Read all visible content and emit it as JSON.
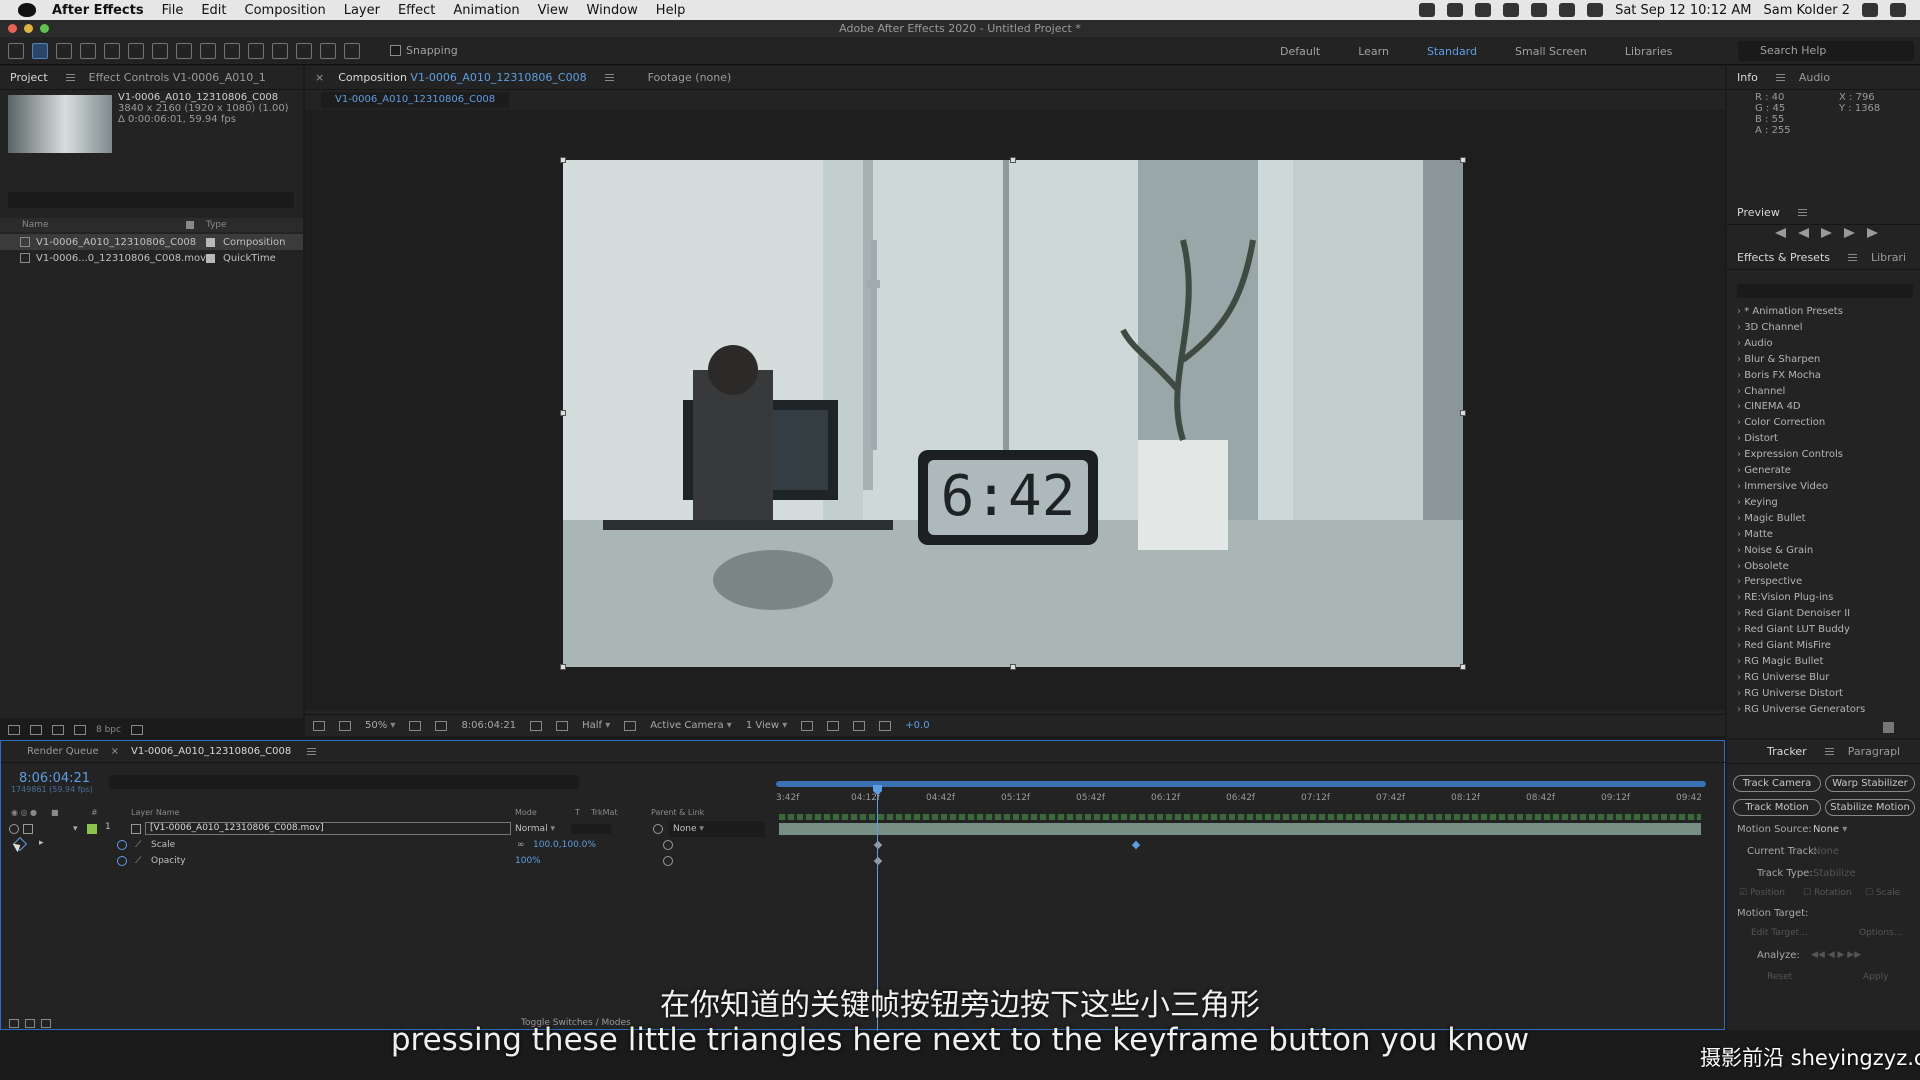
{
  "menubar": {
    "app_name": "After Effects",
    "items": [
      "File",
      "Edit",
      "Composition",
      "Layer",
      "Effect",
      "Animation",
      "View",
      "Window",
      "Help"
    ],
    "clock": "Sat Sep 12  10:12 AM",
    "user": "Sam Kolder 2"
  },
  "window_title": "Adobe After Effects 2020 - Untitled Project *",
  "toolbar": {
    "snapping_label": "Snapping",
    "workspaces": [
      "Default",
      "Learn",
      "Standard",
      "Small Screen",
      "Libraries"
    ],
    "active_workspace": "Standard",
    "search_placeholder": "Search Help"
  },
  "project": {
    "tab_project": "Project",
    "tab_effect_controls": "Effect Controls V1-0006_A010_1",
    "selected_name": "V1-0006_A010_12310806_C008",
    "resolution": "3840 x 2160  (1920 x 1080) (1.00)",
    "duration": "Δ 0:00:06:01, 59.94 fps",
    "col_name": "Name",
    "col_type": "Type",
    "bpc": "8 bpc",
    "items": [
      {
        "name": "V1-0006_A010_12310806_C008",
        "type": "Composition"
      },
      {
        "name": "V1-0006...0_12310806_C008.mov",
        "type": "QuickTime"
      }
    ]
  },
  "composition": {
    "tab_label": "Composition",
    "comp_name": "V1-0006_A010_12310806_C008",
    "footage_tab": "Footage (none)",
    "sub_tab": "V1-0006_A010_12310806_C008",
    "zoom": "50%",
    "timecode": "8:06:04:21",
    "resolution": "Half",
    "camera": "Active Camera",
    "views": "1 View",
    "exposure": "+0.0",
    "clock_display": "6:42"
  },
  "info": {
    "tab_info": "Info",
    "tab_audio": "Audio",
    "r": "R : 40",
    "g": "G : 45",
    "b": "B : 55",
    "a": "A : 255",
    "x": "X : 796",
    "y": "Y : 1368"
  },
  "preview": {
    "tab": "Preview"
  },
  "effects": {
    "tab": "Effects & Presets",
    "tab_libraries": "Librari",
    "items": [
      "* Animation Presets",
      "3D Channel",
      "Audio",
      "Blur & Sharpen",
      "Boris FX Mocha",
      "Channel",
      "CINEMA 4D",
      "Color Correction",
      "Distort",
      "Expression Controls",
      "Generate",
      "Immersive Video",
      "Keying",
      "Magic Bullet",
      "Matte",
      "Noise & Grain",
      "Obsolete",
      "Perspective",
      "RE:Vision Plug-ins",
      "Red Giant Denoiser II",
      "Red Giant LUT Buddy",
      "Red Giant MisFire",
      "RG Magic Bullet",
      "RG Universe Blur",
      "RG Universe Distort",
      "RG Universe Generators"
    ]
  },
  "timeline": {
    "tab_render_queue": "Render Queue",
    "tab_comp": "V1-0006_A010_12310806_C008",
    "current_time": "8:06:04:21",
    "frame_info": "1749861 (59.94 fps)",
    "col_layer_name": "Layer Name",
    "col_mode": "Mode",
    "col_t": "T",
    "col_trkmat": "TrkMat",
    "col_parent": "Parent & Link",
    "col_num": "#",
    "layer_index": "1",
    "layer_name": "[V1-0006_A010_12310806_C008.mov]",
    "layer_mode": "Normal",
    "layer_parent": "None",
    "props": [
      {
        "name": "Scale",
        "value": "100.0,100.0%"
      },
      {
        "name": "Opacity",
        "value": "100%"
      }
    ],
    "ticks": [
      "3:42f",
      "04:12f",
      "04:42f",
      "05:12f",
      "05:42f",
      "06:12f",
      "06:42f",
      "07:12f",
      "07:42f",
      "08:12f",
      "08:42f",
      "09:12f",
      "09:42"
    ],
    "toggle_label": "Toggle Switches / Modes"
  },
  "tracker": {
    "tab": "Tracker",
    "tab_paragraph": "Paragrapl",
    "btn_track_camera": "Track Camera",
    "btn_warp_stabilizer": "Warp Stabilizer",
    "btn_track_motion": "Track Motion",
    "btn_stabilize_motion": "Stabilize Motion",
    "motion_source_label": "Motion Source:",
    "motion_source_value": "None",
    "current_track_label": "Current Track:",
    "current_track_value": "None",
    "track_type_label": "Track Type:",
    "track_type_value": "Stabilize",
    "chk_position": "Position",
    "chk_rotation": "Rotation",
    "chk_scale": "Scale",
    "motion_target_label": "Motion Target:",
    "edit_target": "Edit Target...",
    "options": "Options...",
    "analyze_label": "Analyze:",
    "reset": "Reset",
    "apply": "Apply"
  },
  "subtitles": {
    "chinese": "在你知道的关键帧按钮旁边按下这些小三角形",
    "english": "pressing these little triangles here next to the keyframe button you know",
    "watermark": "摄影前沿 sheyingzyz.com"
  },
  "colors": {
    "accent": "#5e9de0",
    "panel": "#232323",
    "track": "#788f84"
  }
}
